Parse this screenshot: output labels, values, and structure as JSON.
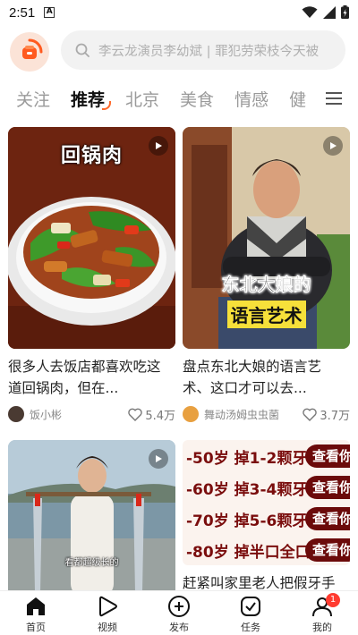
{
  "status": {
    "time": "2:51",
    "notif_letter": "A"
  },
  "search": {
    "placeholder": "李云龙演员李幼斌 | 罪犯劳荣枝今天被"
  },
  "tabs": [
    {
      "label": "关注"
    },
    {
      "label": "推荐"
    },
    {
      "label": "北京"
    },
    {
      "label": "美食"
    },
    {
      "label": "情感"
    },
    {
      "label": "健"
    }
  ],
  "feed": {
    "cards": [
      {
        "overlay": "回锅肉",
        "title": "很多人去饭店都喜欢吃这道回锅肉，但在...",
        "author": "饭小彬",
        "likes": "5.4万"
      },
      {
        "overlay_line1": "东北大娘的",
        "overlay_line2": "语言艺术",
        "title": "盘点东北大娘的语言艺术、这口才可以去...",
        "author": "舞动汤姆虫虫菌",
        "likes": "3.7万"
      },
      {
        "overlay": "看都超级长的"
      },
      {
        "rows": [
          {
            "text": "-50岁  掉1-2颗牙",
            "button": "查看你"
          },
          {
            "text": "-60岁  掉3-4颗牙",
            "button": "查看你"
          },
          {
            "text": "-70岁  掉5-6颗牙",
            "button": "查看你"
          },
          {
            "text": "-80岁  掉半口全口",
            "button": "查看你"
          }
        ],
        "title": "赶紧叫家里老人把假牙手"
      }
    ]
  },
  "nav": [
    {
      "label": "首页"
    },
    {
      "label": "视频"
    },
    {
      "label": "发布"
    },
    {
      "label": "任务"
    },
    {
      "label": "我的",
      "badge": "1"
    }
  ]
}
